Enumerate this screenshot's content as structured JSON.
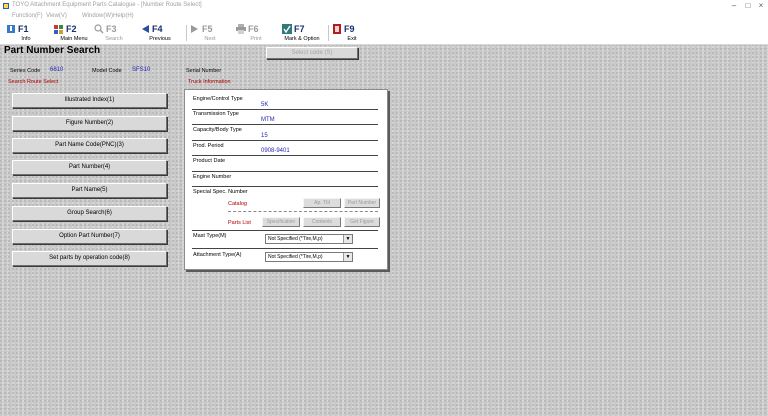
{
  "window": {
    "title": "TOYO Attachment Equipment Parts Catalogue - [Number Route Select]",
    "min_glyph": "–",
    "max_glyph": "□",
    "close_glyph": "×"
  },
  "menu": [
    "Function(F)",
    "View(V)",
    "Window(W)",
    "Help(H)"
  ],
  "toolbar": [
    {
      "key": "F1",
      "label": "Info",
      "icon": "info-icon",
      "enabled": true
    },
    {
      "key": "F2",
      "label": "Main Menu",
      "icon": "main-menu-icon",
      "enabled": true
    },
    {
      "key": "F3",
      "label": "Search",
      "icon": "search-icon",
      "enabled": false
    },
    {
      "key": "F4",
      "label": "Previous",
      "icon": "previous-icon",
      "enabled": true
    },
    {
      "key": "F5",
      "label": "Next",
      "icon": "next-icon",
      "enabled": false
    },
    {
      "key": "F6",
      "label": "Print",
      "icon": "print-icon",
      "enabled": false
    },
    {
      "key": "F7",
      "label": "Mark & Option",
      "icon": "mark-option-icon",
      "enabled": true
    },
    {
      "key": "F9",
      "label": "Exit",
      "icon": "exit-icon",
      "enabled": true
    }
  ],
  "page": {
    "title": "Part Number Search",
    "select_button": "Select code (S)"
  },
  "info_row": {
    "series_code_label": "Series Code",
    "series_code_value": "6810",
    "model_code_label": "Model Code",
    "model_code_value": "SFS10",
    "serial_number_label": "Serial Number",
    "serial_number_value": ""
  },
  "section_headers": {
    "left": "Search Route Select",
    "right": "Truck Information"
  },
  "route_buttons": [
    "Illustrated Index(1)",
    "Figure Number(2)",
    "Part Name Code(PNC)(3)",
    "Part Number(4)",
    "Part Name(5)",
    "Group Search(6)",
    "Option Part Number(7)",
    "Set parts by operation code(8)"
  ],
  "truck_info": {
    "engine_control_type_label": "Engine/Control Type",
    "engine_control_type_value": "5K",
    "transmission_type_label": "Transmission Type",
    "transmission_type_value": "MTM",
    "capacity_body_type_label": "Capacity/Body Type",
    "capacity_body_type_value": "15",
    "prod_period_label": "Prod. Period",
    "prod_period_value": "0908-9401",
    "product_date_label": "Product Date",
    "product_date_value": "",
    "engine_number_label": "Engine Number",
    "engine_number_value": "",
    "special_spec_label": "Special Spec. Number",
    "catalog_label": "Catalog",
    "parts_list_label": "Parts List",
    "catalog_buttons": [
      "Ap. Tbl",
      "Part Number"
    ],
    "parts_list_buttons": [
      "Specification",
      "Contents",
      "Get Figure"
    ],
    "mast_type_label": "Mast Type(M)",
    "mast_type_value": "Not Specified (*Tire,M,p)",
    "attachment_type_label": "Attachment Type(A)",
    "attachment_type_value": "Not Specified (*Tire,M,p)"
  },
  "colors": {
    "label_red": "#b00000",
    "value_blue": "#1f1fb4",
    "function_key": "#1a2d6e"
  }
}
